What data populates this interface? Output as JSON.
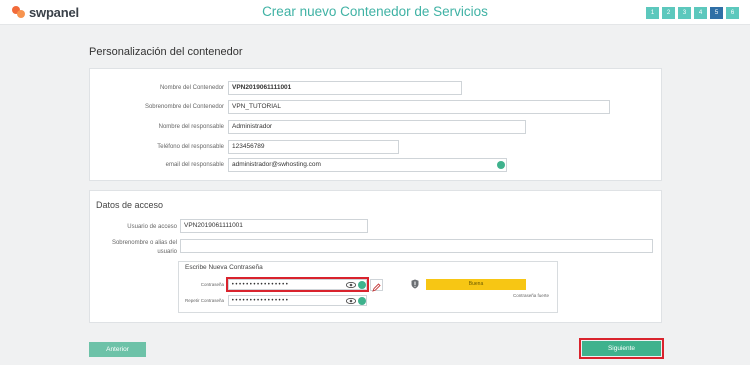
{
  "header": {
    "logo_text": "swpanel",
    "title": "Crear nuevo Contenedor de Servicios",
    "steps": [
      "1",
      "2",
      "3",
      "4",
      "5",
      "6"
    ],
    "active_step": "5"
  },
  "container": {
    "heading": "Personalización del contenedor",
    "fields": {
      "name": {
        "label": "Nombre del Contenedor",
        "value": "VPN2019061111001"
      },
      "nickname": {
        "label": "Sobrenombre del Contenedor",
        "value": "VPN_TUTORIAL"
      },
      "owner": {
        "label": "Nombre del responsable",
        "value": "Administrador"
      },
      "phone": {
        "label": "Teléfono del responsable",
        "value": "123456789"
      },
      "email": {
        "label": "email del responsable",
        "value": "administrador@swhosting.com"
      }
    }
  },
  "access": {
    "heading": "Datos de acceso",
    "username": {
      "label": "Usuario de acceso",
      "value": "VPN2019061111001"
    },
    "alias": {
      "label": "Sobrenombre o alias del usuario",
      "value": ""
    },
    "password_box": {
      "title": "Escribe Nueva Contraseña",
      "password": {
        "label": "Contraseña",
        "value": "••••••••••••••••"
      },
      "repeat": {
        "label": "Repetir Contraseña",
        "value": "••••••••••••••••"
      },
      "strength_value": "Buena",
      "strength_label": "Contraseña fuerte"
    }
  },
  "buttons": {
    "previous": "Anterior",
    "next": "Siguiente"
  },
  "colors": {
    "accent": "#3fb2a4",
    "success": "#3fb28d",
    "highlight": "#d9232d",
    "strength": "#f7c614"
  }
}
